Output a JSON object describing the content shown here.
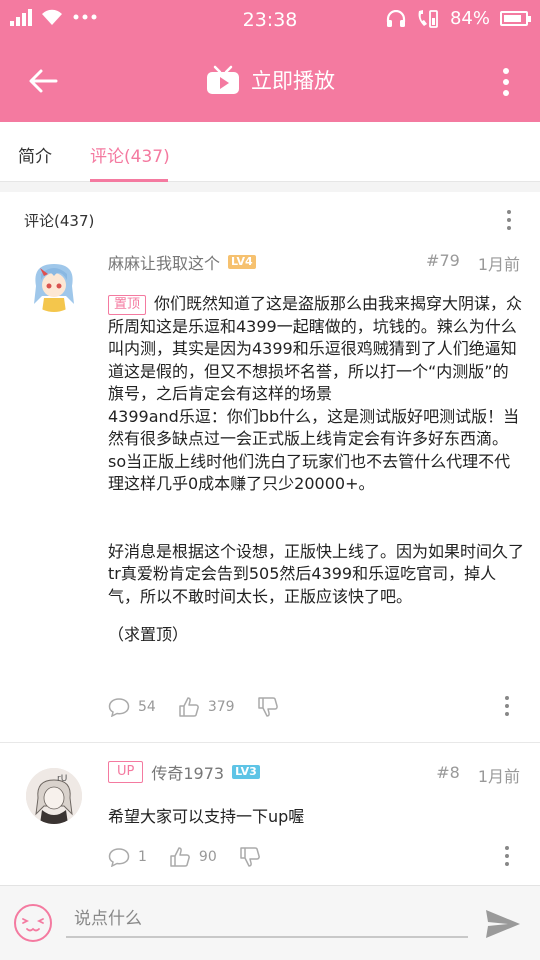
{
  "status": {
    "time": "23:38",
    "battery": "84%",
    "battery_level": 0.84
  },
  "appbar": {
    "title": "立即播放"
  },
  "tabs": [
    {
      "label": "简介",
      "active": false
    },
    {
      "label": "评论(437)",
      "active": true
    }
  ],
  "comments_header": "评论(437)",
  "comments": [
    {
      "username": "麻麻让我取这个",
      "level": "LV4",
      "floor": "#79",
      "time": "1月前",
      "tag": "置顶",
      "paragraphs": [
        "你们既然知道了这是盗版那么由我来揭穿大阴谋，众所周知这是乐逗和4399一起瞎做的，坑钱的。辣么为什么叫内测，其实是因为4399和乐逗很鸡贼猜到了人们绝逼知道这是假的，但又不想损坏名誉，所以打一个“内测版”的旗号，之后肯定会有这样的场景",
        "4399and乐逗：你们bb什么，这是测试版好吧测试版！当然有很多缺点过一会正式版上线肯定会有许多好东西滴。",
        "so当正版上线时他们洗白了玩家们也不去管什么代理不代理这样几乎0成本赚了只少20000+。",
        "",
        "好消息是根据这个设想，正版快上线了。因为如果时间久了tr真爱粉肯定会告到505然后4399和乐逗吃官司，掉人气，所以不敢时间太长，正版应该快了吧。",
        "（求置顶）"
      ],
      "reply_count": "54",
      "like_count": "379"
    },
    {
      "username": "传奇1973",
      "level": "LV3",
      "floor": "#8",
      "time": "1月前",
      "tag": "UP",
      "text": "希望大家可以支持一下up喔",
      "reply_count": "1",
      "like_count": "90"
    }
  ],
  "input": {
    "placeholder": "说点什么"
  },
  "colors": {
    "accent": "#f47aa0",
    "lv4": "#f6c16f",
    "lv3": "#5ec4e6"
  }
}
